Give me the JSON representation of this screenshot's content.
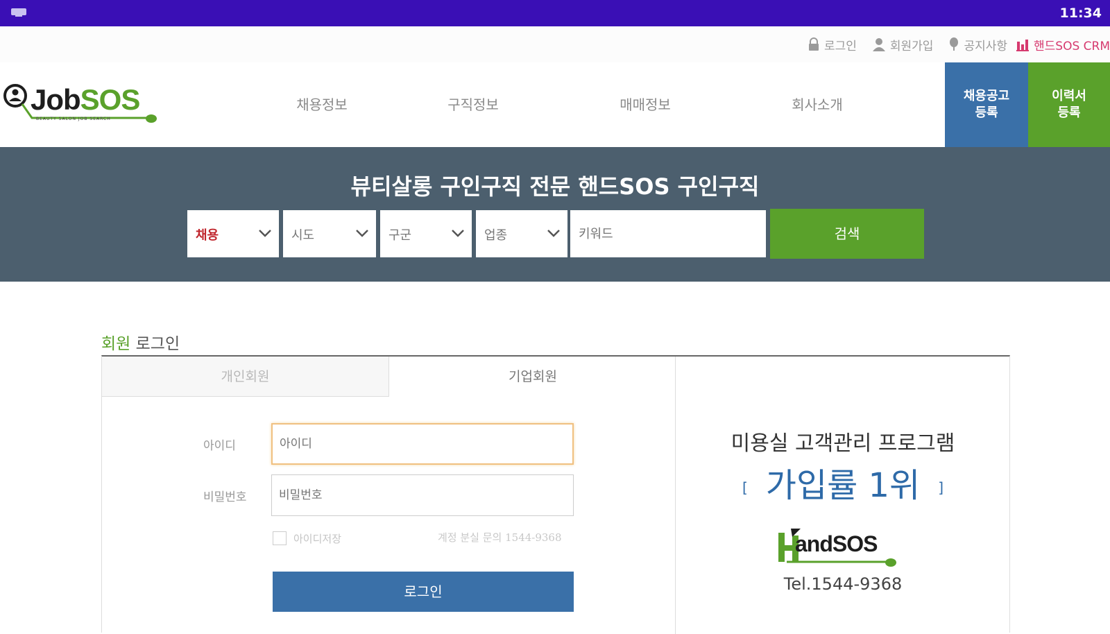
{
  "status_bar": {
    "time": "11:34"
  },
  "top_links": {
    "login": "로그인",
    "signup": "회원가입",
    "notice": "공지사항",
    "crm": "핸드SOS CRM"
  },
  "logo": {
    "brand_a": "Job",
    "brand_b": "SOS",
    "tagline": "BEAUTY SALON JOB SEARCH"
  },
  "nav": {
    "items": [
      "채용정보",
      "구직정보",
      "매매정보",
      "회사소개"
    ]
  },
  "header_buttons": {
    "job_post_line1": "채용공고",
    "job_post_line2": "등록",
    "resume_line1": "이력서",
    "resume_line2": "등록"
  },
  "banner": {
    "title": "뷰티살롱 구인구직 전문 핸드SOS 구인구직",
    "selects": [
      "채용",
      "시도",
      "구군",
      "업종"
    ],
    "keyword_placeholder": "키워드",
    "search_label": "검색"
  },
  "login": {
    "title_accent": "회원",
    "title_rest": " 로그인",
    "tab_personal": "개인회원",
    "tab_company": "기업회원",
    "id_label": "아이디",
    "id_placeholder": "아이디",
    "pw_label": "비밀번호",
    "pw_placeholder": "비밀번호",
    "remember_label": "아이디저장",
    "contact": "계정 분실 문의 1544-9368",
    "button_label": "로그인"
  },
  "promo": {
    "line1": "미용실 고객관리 프로그램",
    "bracket_open": "[",
    "line2": "가입률 1위",
    "bracket_close": "]",
    "logo_text": "andSOS",
    "tel": "Tel.1544-9368"
  },
  "colors": {
    "status_bar": "#3a0fb5",
    "brand_green": "#5aa12b",
    "brand_blue": "#3a70a8",
    "banner_bg": "#4c5f6e",
    "crm_pink": "#d63a6f"
  }
}
